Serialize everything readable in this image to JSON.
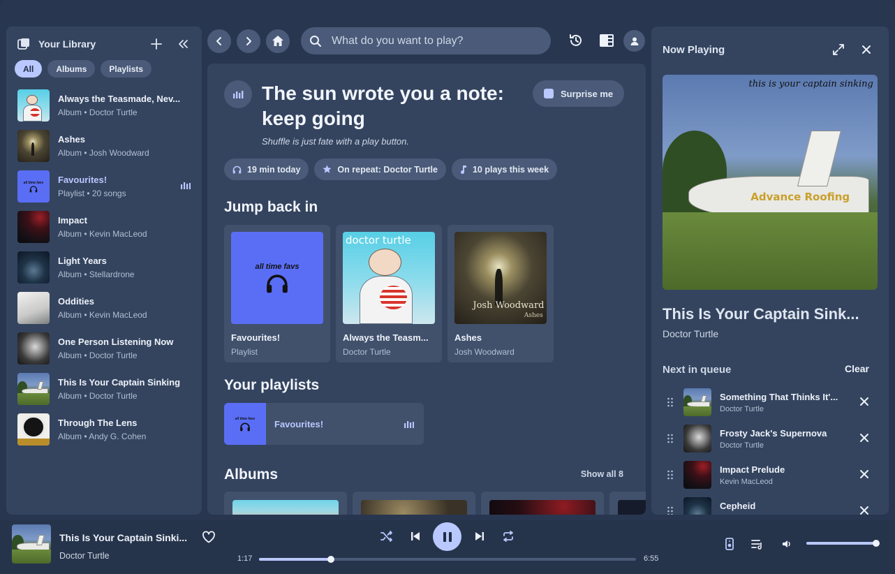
{
  "library": {
    "title": "Your Library",
    "filters": [
      "All",
      "Albums",
      "Playlists"
    ],
    "items": [
      {
        "name": "Always the Teasmade, Nev...",
        "sub": "Album • Doctor Turtle",
        "art": "teasmade"
      },
      {
        "name": "Ashes",
        "sub": "Album • Josh Woodward",
        "art": "ashes"
      },
      {
        "name": "Favourites!",
        "sub": "Playlist • 20 songs",
        "art": "favs",
        "playing": true
      },
      {
        "name": "Impact",
        "sub": "Album • Kevin MacLeod",
        "art": "impact"
      },
      {
        "name": "Light Years",
        "sub": "Album • Stellardrone",
        "art": "lightyears"
      },
      {
        "name": "Oddities",
        "sub": "Album • Kevin MacLeod",
        "art": "oddities"
      },
      {
        "name": "One Person Listening Now",
        "sub": "Album • Doctor Turtle",
        "art": "oneperson"
      },
      {
        "name": "This Is Your Captain Sinking",
        "sub": "Album • Doctor Turtle",
        "art": "captain"
      },
      {
        "name": "Through The Lens",
        "sub": "Album • Andy G. Cohen",
        "art": "lens"
      }
    ]
  },
  "search": {
    "placeholder": "What do you want to play?"
  },
  "hero": {
    "title": "The sun wrote you a note: keep going",
    "subtitle": "Shuffle is just fate with a play button.",
    "surprise": "Surprise me",
    "stats": [
      "19 min today",
      "On repeat: Doctor Turtle",
      "10 plays this week"
    ]
  },
  "sections": {
    "jump": "Jump back in",
    "playlists": "Your playlists",
    "albums": "Albums",
    "show_all": "Show all 8"
  },
  "jump_cards": [
    {
      "title": "Favourites!",
      "sub": "Playlist",
      "art": "favs"
    },
    {
      "title": "Always the Teasm...",
      "sub": "Doctor Turtle",
      "art": "teasmade"
    },
    {
      "title": "Ashes",
      "sub": "Josh Woodward",
      "art": "ashes"
    }
  ],
  "playlist_row": {
    "title": "Favourites!"
  },
  "art_text": {
    "favs": "all time favs",
    "teasmade": "doctor turtle",
    "ashes_artist": "Josh Woodward",
    "ashes_title": "Ashes",
    "captain_caption": "this is your captain sinking",
    "captain_sign": "Advance Roofing"
  },
  "now_playing": {
    "panel_title": "Now Playing",
    "track": "This Is Your Captain Sink...",
    "artist": "Doctor Turtle",
    "queue_title": "Next in queue",
    "clear": "Clear",
    "queue": [
      {
        "title": "Something That Thinks It'...",
        "artist": "Doctor Turtle",
        "art": "captain"
      },
      {
        "title": "Frosty Jack's Supernova",
        "artist": "Doctor Turtle",
        "art": "oneperson"
      },
      {
        "title": "Impact Prelude",
        "artist": "Kevin MacLeod",
        "art": "impact"
      },
      {
        "title": "Cepheid",
        "artist": "Stellardrone",
        "art": "lightyears"
      }
    ]
  },
  "player": {
    "track": "This Is Your Captain Sinki...",
    "artist": "Doctor Turtle",
    "current": "1:17",
    "total": "6:55",
    "progress": 0.19,
    "volume": 1.0
  },
  "colors": {
    "accent": "#b9c8ff",
    "panel": "#34445f",
    "bg": "#283650",
    "favs": "#5a6ef5"
  },
  "icons": [
    "library-icon",
    "plus-icon",
    "collapse-icon",
    "back-icon",
    "forward-icon",
    "home-icon",
    "search-icon",
    "history-icon",
    "layout-icon",
    "user-icon",
    "equalizer-icon",
    "dice-icon",
    "headphones-icon",
    "star-icon",
    "music-note-icon",
    "expand-icon",
    "close-icon",
    "drag-handle-icon",
    "heart-icon",
    "shuffle-icon",
    "previous-icon",
    "pause-icon",
    "next-icon",
    "repeat-icon",
    "device-icon",
    "queue-icon",
    "volume-icon"
  ]
}
